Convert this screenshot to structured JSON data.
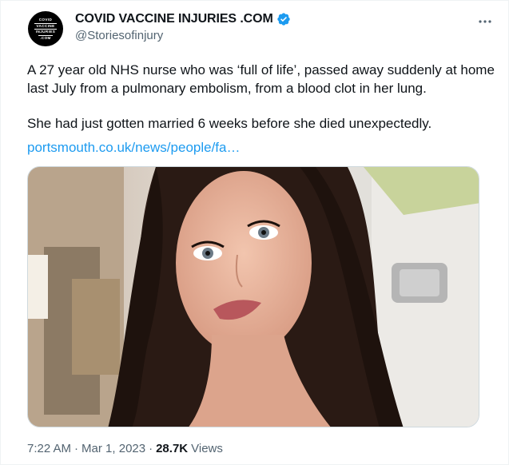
{
  "author": {
    "avatar_lines": [
      "COVID",
      "VACCINE",
      "INJURIES",
      ".COM"
    ],
    "display_name": "COVID VACCINE INJURIES .COM",
    "handle": "@Storiesofinjury",
    "verified": true,
    "verified_color": "#1d9bf0"
  },
  "tweet": {
    "paragraph1": "A 27 year old NHS nurse who was ‘full of life’, passed away suddenly at home last July from a pulmonary embolism, from a blood clot in her lung.",
    "paragraph2": "She had just gotten married 6 weeks before she died unexpectedly.",
    "link_text": "portsmouth.co.uk/news/people/fa…"
  },
  "media": {
    "icon": "photo-image"
  },
  "footer": {
    "time": "7:22 AM",
    "separator1": "·",
    "date": "Mar 1, 2023",
    "separator2": "·",
    "views_count": "28.7K",
    "views_label": "Views"
  },
  "colors": {
    "link": "#1d9bf0",
    "secondary_text": "#536471",
    "primary_text": "#0f1419"
  }
}
